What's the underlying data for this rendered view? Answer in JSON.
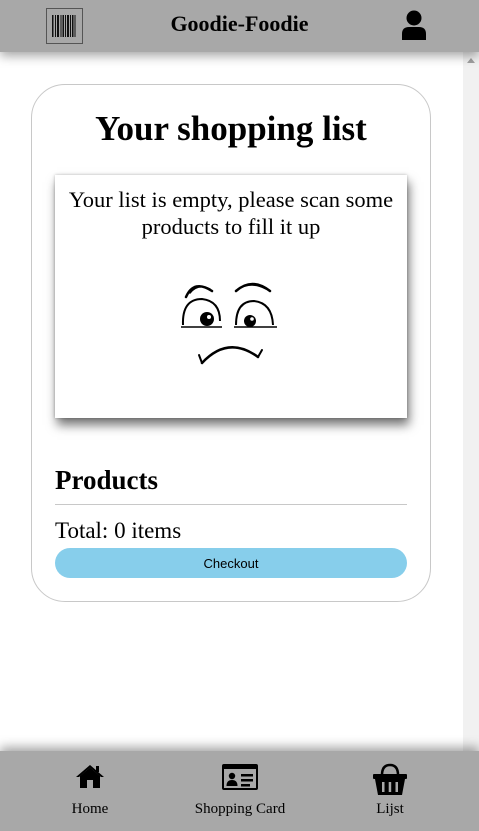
{
  "header": {
    "title": "Goodie-Foodie",
    "scan_icon": "barcode-icon",
    "user_icon": "user-icon"
  },
  "main": {
    "title": "Your shopping list",
    "empty_message": "Your list is empty, please scan some products to fill it up",
    "empty_icon": "sad-face-icon",
    "products_heading": "Products",
    "total_text": "Total: 0 items",
    "checkout_label": "Checkout"
  },
  "nav": {
    "items": [
      {
        "label": "Home",
        "icon": "home-icon"
      },
      {
        "label": "Shopping Card",
        "icon": "id-card-icon"
      },
      {
        "label": "Lijst",
        "icon": "basket-icon"
      }
    ]
  },
  "colors": {
    "bar_background": "#a8a8a8",
    "checkout_button": "#87ceeb",
    "card_border": "#c8c8c8"
  }
}
